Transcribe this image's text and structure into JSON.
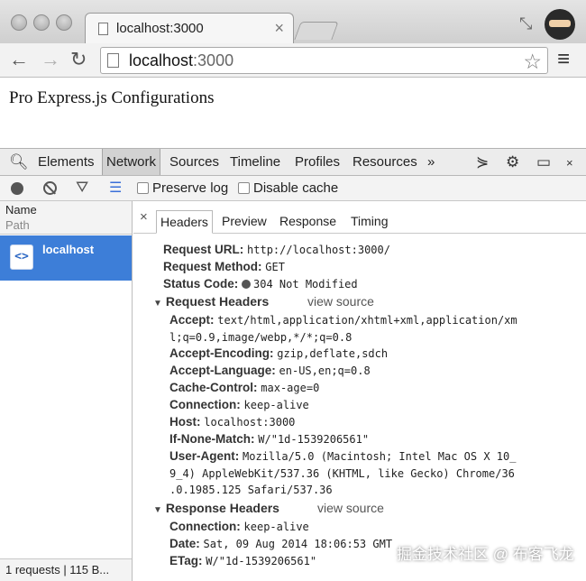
{
  "browser": {
    "tab_title": "localhost:3000",
    "tab_close": "×",
    "url_host": "localhost",
    "url_port": ":3000"
  },
  "page": {
    "heading": "Pro Express.js Configurations"
  },
  "devtools": {
    "tabs": [
      "Elements",
      "Network",
      "Sources",
      "Timeline",
      "Profiles",
      "Resources"
    ],
    "active_tab": "Network",
    "more": "»",
    "preserve_log": "Preserve log",
    "disable_cache": "Disable cache",
    "columns": {
      "name": "Name",
      "path": "Path"
    },
    "request_name": "localhost",
    "status": "1 requests | 115 B...",
    "detail_tabs": [
      "Headers",
      "Preview",
      "Response",
      "Timing"
    ],
    "detail_close": "×",
    "general": {
      "request_url_label": "Request URL:",
      "request_url": "http://localhost:3000/",
      "request_method_label": "Request Method:",
      "request_method": "GET",
      "status_code_label": "Status Code:",
      "status_code": "304 Not Modified"
    },
    "request_headers_title": "Request Headers",
    "response_headers_title": "Response Headers",
    "view_source": "view source",
    "request_headers": {
      "accept_label": "Accept:",
      "accept_1": "text/html,application/xhtml+xml,application/xm",
      "accept_2": "l;q=0.9,image/webp,*/*;q=0.8",
      "accept_encoding_label": "Accept-Encoding:",
      "accept_encoding": "gzip,deflate,sdch",
      "accept_language_label": "Accept-Language:",
      "accept_language": "en-US,en;q=0.8",
      "cache_control_label": "Cache-Control:",
      "cache_control": "max-age=0",
      "connection_label": "Connection:",
      "connection": "keep-alive",
      "host_label": "Host:",
      "host": "localhost:3000",
      "if_none_match_label": "If-None-Match:",
      "if_none_match": "W/\"1d-1539206561\"",
      "user_agent_label": "User-Agent:",
      "user_agent_1": "Mozilla/5.0 (Macintosh; Intel Mac OS X 10_",
      "user_agent_2": "9_4) AppleWebKit/537.36 (KHTML, like Gecko) Chrome/36",
      "user_agent_3": ".0.1985.125 Safari/537.36"
    },
    "response_headers": {
      "connection_label": "Connection:",
      "connection": "keep-alive",
      "date_label": "Date:",
      "date": "Sat, 09 Aug 2014 18:06:53 GMT",
      "etag_label": "ETag:",
      "etag": "W/\"1d-1539206561\""
    }
  },
  "watermark": "掘金技术社区 @ 布客飞龙"
}
